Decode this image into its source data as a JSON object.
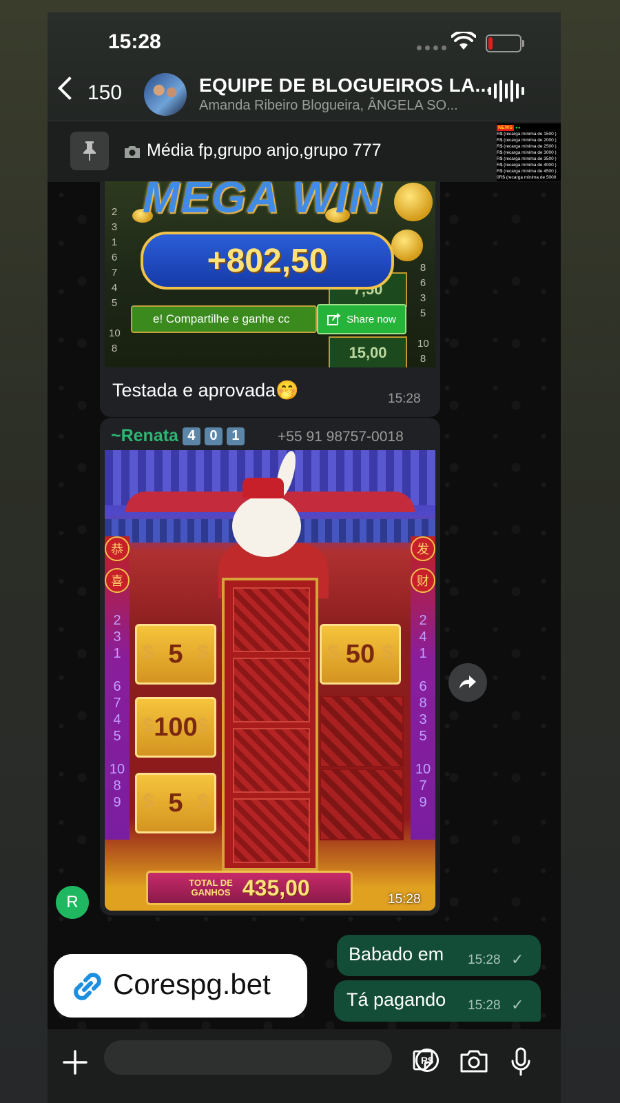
{
  "status_bar": {
    "time": "15:28"
  },
  "header": {
    "back_count": "150",
    "title": "EQUIPE DE BLOGUEIROS LA...",
    "subtitle": "Amanda Ribeiro Blogueira, ÂNGELA SO..."
  },
  "pinned": {
    "text": "Média fp,grupo anjo,grupo 777",
    "thumb_badge": "NEWS",
    "thumb_lines": [
      "R$ (recarga mínima de 1500 )",
      "R$ (recarga mínima de 2000 )",
      "R$ (recarga mínima de 2500 )",
      "R$ (recarga mínima de 3000 )",
      "R$ (recarga mínima de 3500 )",
      "R$ (recarga mínima de 4000 )",
      "R$ (recarga mínima de 4500 )",
      "0R$ (recarga mínima de 5000"
    ]
  },
  "messages": [
    {
      "type": "image_caption",
      "image": {
        "banner": "MEGA WIN",
        "amount": "+802,50",
        "share_strip": "e! Compartilhe e ganhe cc",
        "share_button": "Share now",
        "side_numbers_left": [
          "2",
          "3",
          "1",
          "6",
          "7",
          "4",
          "5",
          "10",
          "8"
        ],
        "side_numbers_right": [
          "8",
          "6",
          "3",
          "5",
          "10",
          "8"
        ],
        "box_small": "7,50",
        "box_bottom": "15,00"
      },
      "caption": "Testada e aprovada🤭",
      "time": "15:28"
    },
    {
      "type": "image",
      "sender": {
        "name": "~Renata",
        "badges": [
          "4",
          "0",
          "1"
        ],
        "phone": "+55 91 98757-0018",
        "avatar_letter": "R"
      },
      "image": {
        "tiles_left": [
          "5",
          "100",
          "5"
        ],
        "tile_right": "50",
        "pillar_left_numbers": [
          "2",
          "3",
          "1",
          "6",
          "7",
          "4",
          "5",
          "10",
          "8",
          "9"
        ],
        "pillar_right_numbers": [
          "2",
          "4",
          "1",
          "6",
          "8",
          "3",
          "5",
          "10",
          "7",
          "9"
        ],
        "sign_left": [
          "恭",
          "喜"
        ],
        "sign_right": [
          "发",
          "财"
        ],
        "total_label_line1": "TOTAL DE",
        "total_label_line2": "GANHOS",
        "total_value": "435,00"
      },
      "time": "15:28"
    },
    {
      "type": "outgoing",
      "text": "Babado em",
      "time": "15:28"
    },
    {
      "type": "outgoing",
      "text": "Tá pagando",
      "time": "15:28"
    }
  ],
  "link_card": {
    "text": "Corespg.bet"
  },
  "composer": {
    "placeholder": ""
  }
}
